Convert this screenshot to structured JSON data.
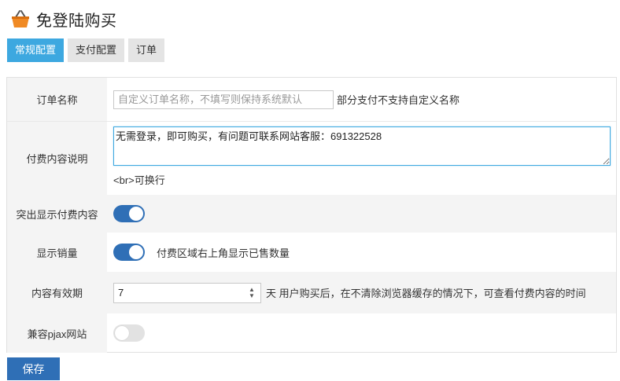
{
  "header": {
    "title": "免登陆购买",
    "icon": "basket-icon"
  },
  "tabs": [
    {
      "label": "常规配置",
      "active": true
    },
    {
      "label": "支付配置",
      "active": false
    },
    {
      "label": "订单",
      "active": false
    }
  ],
  "form": {
    "order_name": {
      "label": "订单名称",
      "placeholder": "自定义订单名称，不填写则保持系统默认",
      "hint": "部分支付不支持自定义名称"
    },
    "paid_content_desc": {
      "label": "付费内容说明",
      "value": "无需登录，即可购买，有问题可联系网站客服：691322528",
      "hint": "<br>可换行"
    },
    "highlight_paid": {
      "label": "突出显示付费内容",
      "enabled": true
    },
    "show_sales": {
      "label": "显示销量",
      "enabled": true,
      "hint": "付费区域右上角显示已售数量"
    },
    "validity": {
      "label": "内容有效期",
      "value": "7",
      "unit_hint": "天 用户购买后，在不清除浏览器缓存的情况下，可查看付费内容的时间"
    },
    "pjax": {
      "label": "兼容pjax网站",
      "enabled": false
    }
  },
  "actions": {
    "save_label": "保存"
  },
  "colors": {
    "accent": "#3da8e0",
    "primary": "#2f6fb6",
    "row_shade": "#f4f4f4",
    "icon_orange": "#f08a24"
  }
}
